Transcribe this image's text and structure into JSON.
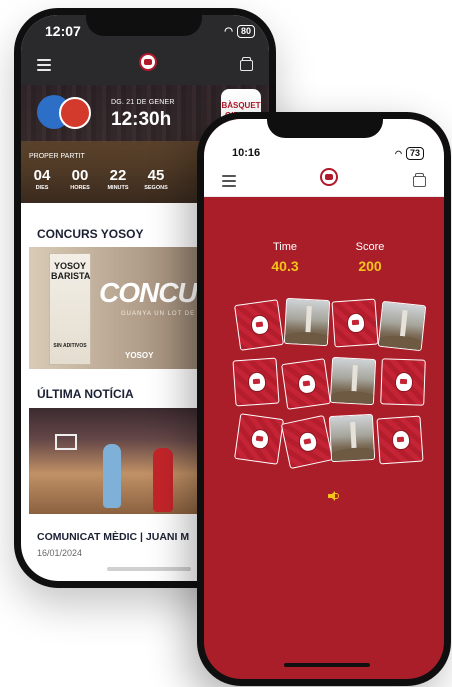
{
  "back_phone": {
    "status_time": "12:07",
    "battery": "80",
    "match_date": "DG. 21 DE GENER",
    "match_time": "12:30h",
    "home_team_logo": "BÀSQUET GIRONA",
    "next_match_label": "PROPER PARTIT",
    "countdown": [
      {
        "value": "04",
        "unit": "DIES"
      },
      {
        "value": "00",
        "unit": "HORES"
      },
      {
        "value": "22",
        "unit": "MINUTS"
      },
      {
        "value": "45",
        "unit": "SEGONS"
      }
    ],
    "contest_section_title": "CONCURS YOSOY",
    "contest_pack_text": "YOSOY BARISTA",
    "contest_pack_sub": "SIN ADITIVOS",
    "contest_banner_text": "CONCURS Y",
    "contest_banner_sub": "GUANYA UN LOT DE PROD",
    "contest_brand": "YOSOY",
    "news_section_title": "ÚLTIMA NOTÍCIA",
    "news_title": "COMUNICAT MÈDIC | JUANI M",
    "news_date": "16/01/2024"
  },
  "front_phone": {
    "status_time": "10:16",
    "battery": "73",
    "time_label": "Time",
    "time_value": "40.3",
    "score_label": "Score",
    "score_value": "200",
    "cards": [
      {
        "face": "emblem"
      },
      {
        "face": "photo"
      },
      {
        "face": "emblem"
      },
      {
        "face": "photo"
      },
      {
        "face": "emblem"
      },
      {
        "face": "emblem"
      },
      {
        "face": "photo"
      },
      {
        "face": "emblem"
      },
      {
        "face": "emblem"
      },
      {
        "face": "emblem"
      },
      {
        "face": "photo"
      },
      {
        "face": "emblem"
      }
    ]
  },
  "colors": {
    "brand_red": "#aa1e2a",
    "accent_yellow": "#f5c21b",
    "navy_text": "#1c2033"
  },
  "icons": [
    "menu-icon",
    "wallet-icon",
    "club-logo-icon",
    "sound-icon",
    "wifi-icon",
    "battery-icon"
  ]
}
